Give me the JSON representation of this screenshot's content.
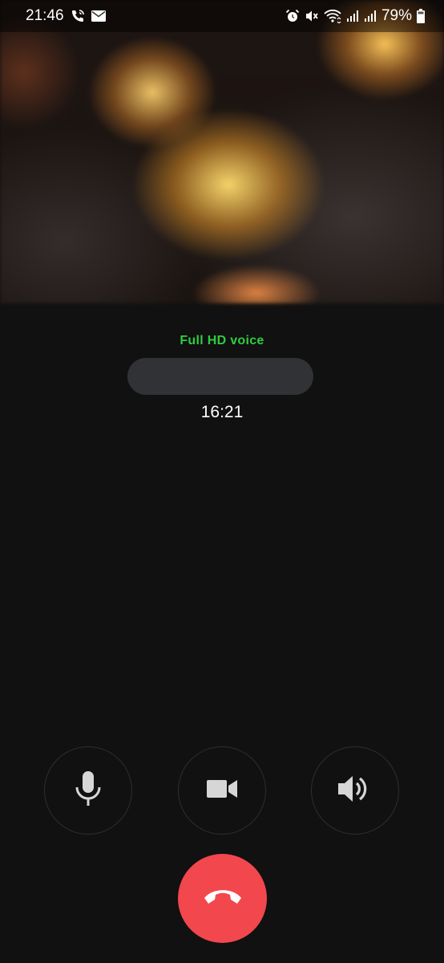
{
  "status_bar": {
    "time": "21:46",
    "battery_percent": "79%",
    "left_icons": [
      "wifi-call-icon",
      "email-icon"
    ],
    "right_icons": [
      "alarm-icon",
      "mute-icon",
      "wifi-icon",
      "signal-icon",
      "signal-icon",
      "battery-icon"
    ]
  },
  "call": {
    "quality_label": "Full HD voice",
    "caller_name": "",
    "duration": "16:21"
  },
  "controls": {
    "mute_icon": "microphone-icon",
    "video_icon": "video-camera-icon",
    "speaker_icon": "speaker-icon",
    "end_call_icon": "end-call-icon"
  },
  "colors": {
    "background": "#111111",
    "hd_voice": "#2ecc40",
    "end_call": "#f2474d",
    "name_pill": "#303236"
  }
}
